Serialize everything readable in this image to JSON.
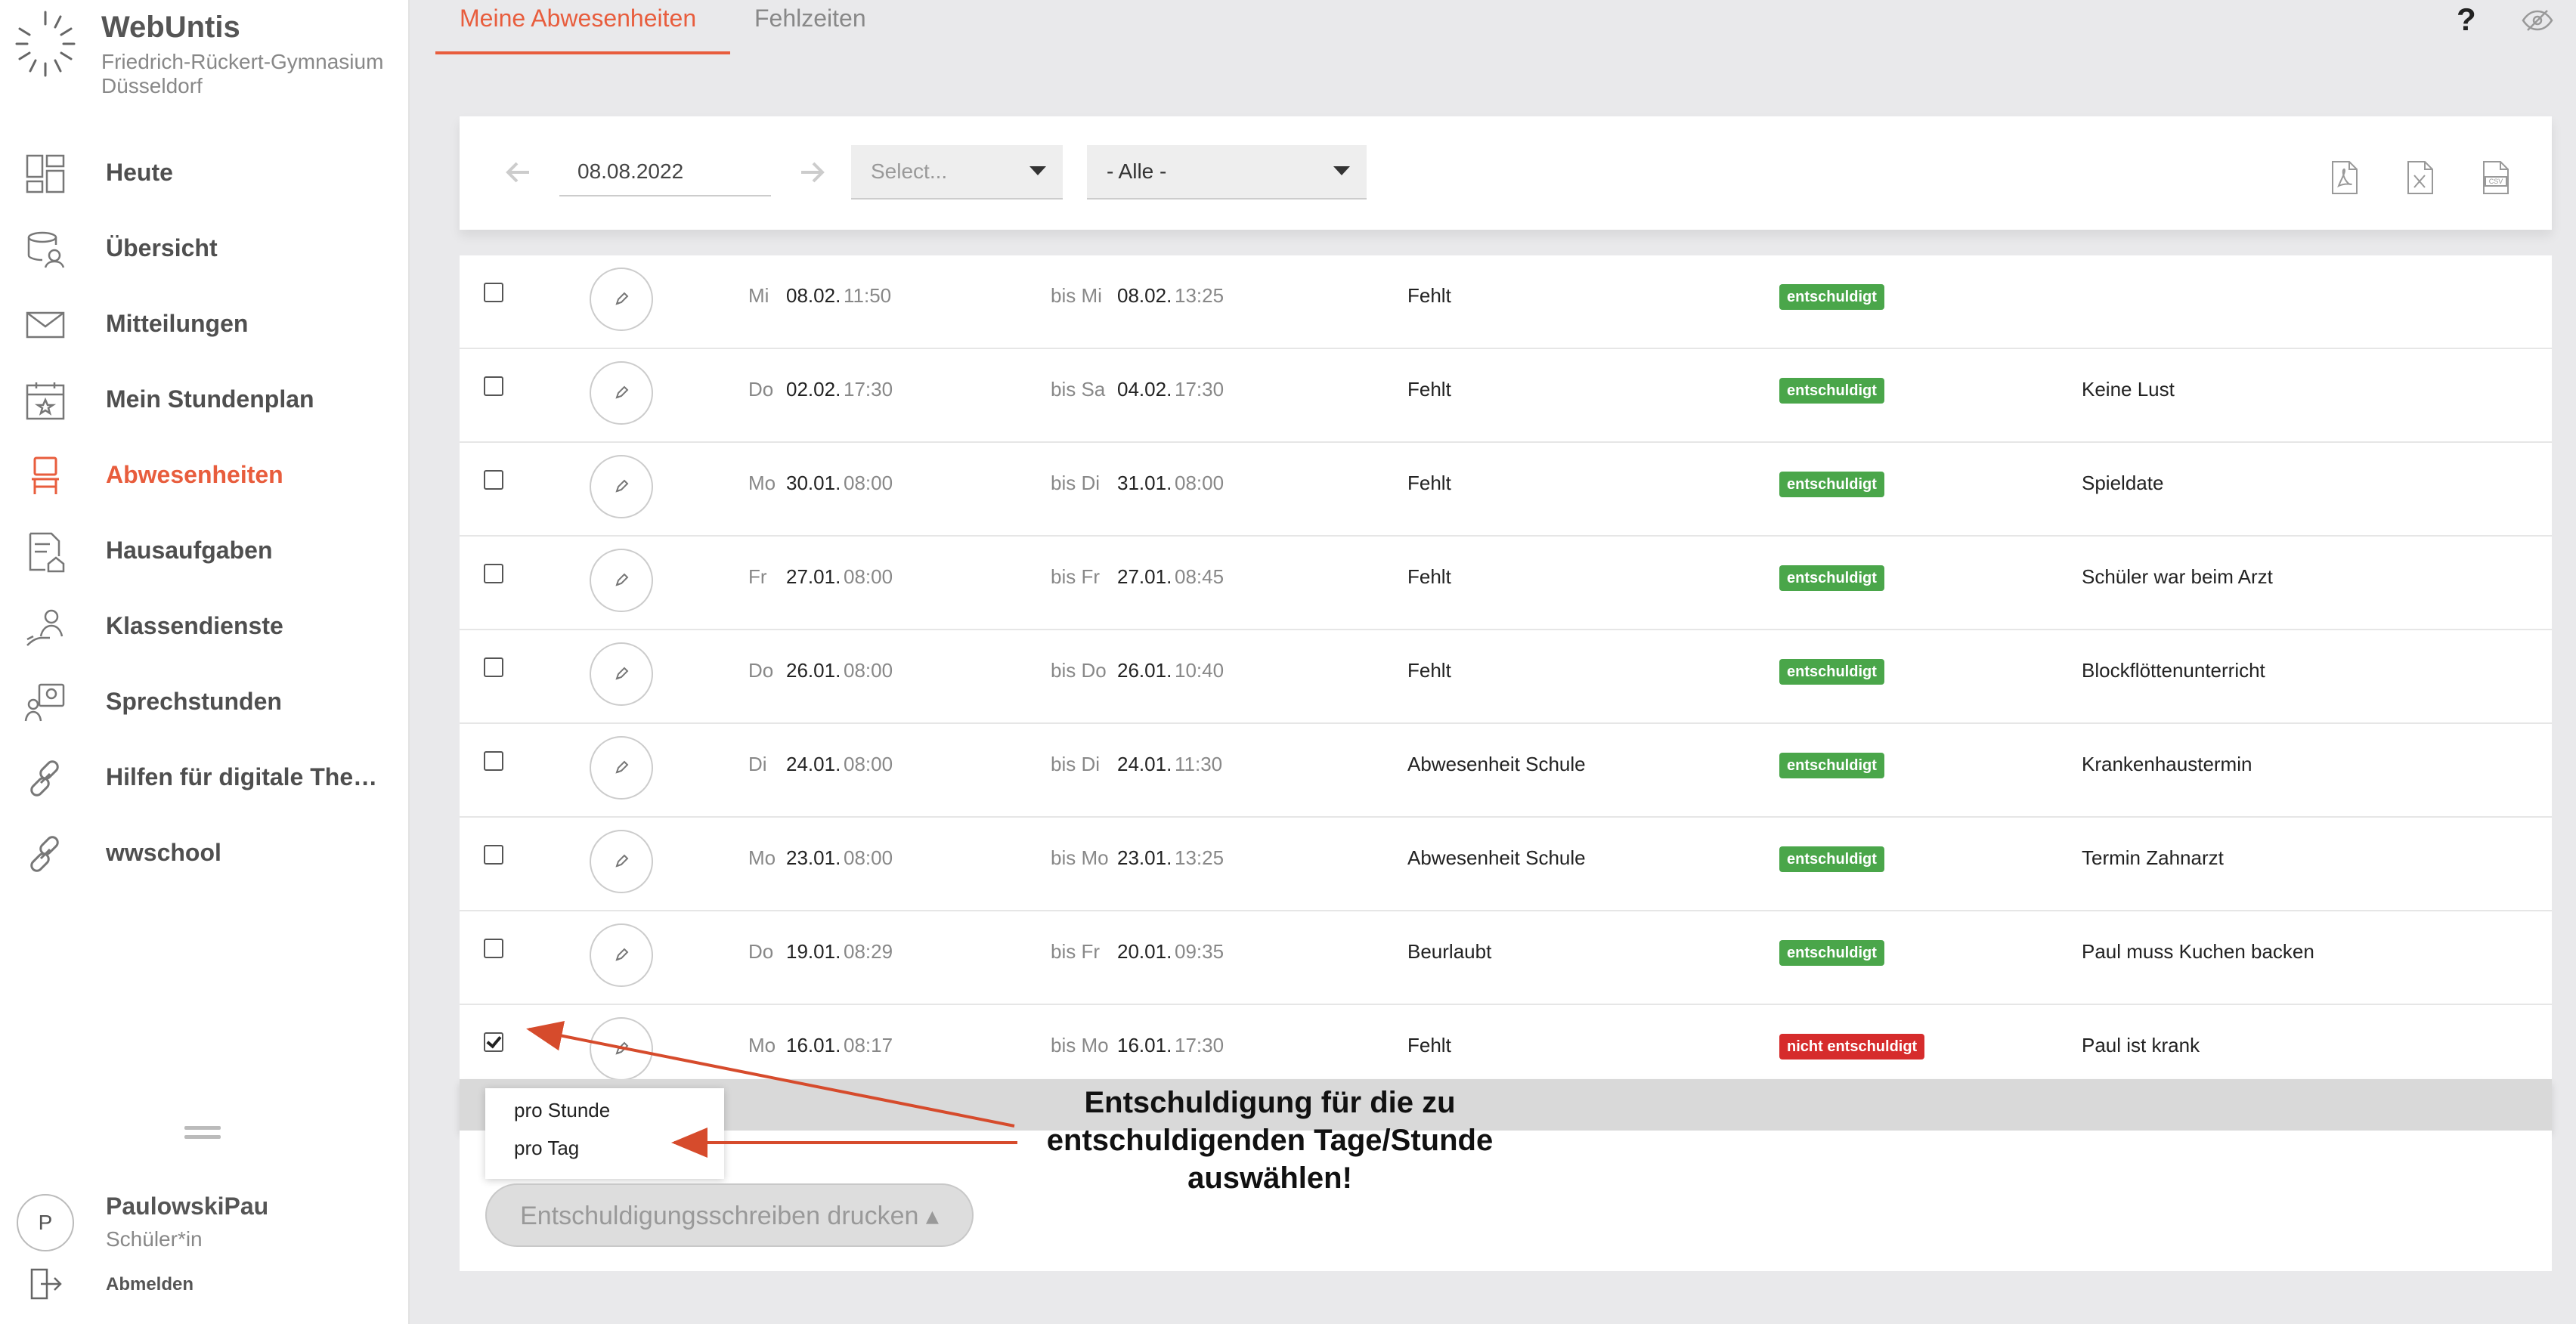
{
  "app": {
    "name": "WebUntis",
    "school": "Friedrich-Rückert-Gymnasium Düsseldorf"
  },
  "sidebar": {
    "items": [
      {
        "label": "Heute",
        "icon": "dashboard-icon",
        "active": false
      },
      {
        "label": "Übersicht",
        "icon": "overview-icon",
        "active": false
      },
      {
        "label": "Mitteilungen",
        "icon": "mail-icon",
        "active": false
      },
      {
        "label": "Mein Stundenplan",
        "icon": "calendar-icon",
        "active": false
      },
      {
        "label": "Abwesenheiten",
        "icon": "chair-icon",
        "active": true
      },
      {
        "label": "Hausaufgaben",
        "icon": "homework-icon",
        "active": false
      },
      {
        "label": "Klassendienste",
        "icon": "class-duty-icon",
        "active": false
      },
      {
        "label": "Sprechstunden",
        "icon": "consultation-icon",
        "active": false
      },
      {
        "label": "Hilfen für digitale The…",
        "icon": "link-icon",
        "active": false
      },
      {
        "label": "wwschool",
        "icon": "link-icon",
        "active": false
      }
    ],
    "user": {
      "initial": "P",
      "name": "PaulowskiPau",
      "role": "Schüler*in",
      "logout": "Abmelden"
    }
  },
  "tabs": [
    {
      "label": "Meine Abwesenheiten",
      "active": true
    },
    {
      "label": "Fehlzeiten",
      "active": false
    }
  ],
  "help": "?",
  "filter": {
    "date": "08.08.2022",
    "select1": "Select...",
    "select2": "- Alle -",
    "exports": [
      "pdf-export-icon",
      "excel-export-icon",
      "csv-export-icon"
    ]
  },
  "colors": {
    "accent": "#e85d3d",
    "excused": "#4aa64a",
    "unexcused": "#d62c2c"
  },
  "rows": [
    {
      "checked": false,
      "fromDay": "Mi",
      "fromDate": "08.02.",
      "fromTime": "11:50",
      "toPrefix": "bis Mi",
      "toDate": "08.02.",
      "toTime": "13:25",
      "reason": "Fehlt",
      "status": "entschuldigt",
      "excused": true,
      "note": ""
    },
    {
      "checked": false,
      "fromDay": "Do",
      "fromDate": "02.02.",
      "fromTime": "17:30",
      "toPrefix": "bis Sa",
      "toDate": "04.02.",
      "toTime": "17:30",
      "reason": "Fehlt",
      "status": "entschuldigt",
      "excused": true,
      "note": "Keine Lust"
    },
    {
      "checked": false,
      "fromDay": "Mo",
      "fromDate": "30.01.",
      "fromTime": "08:00",
      "toPrefix": "bis Di",
      "toDate": "31.01.",
      "toTime": "08:00",
      "reason": "Fehlt",
      "status": "entschuldigt",
      "excused": true,
      "note": "Spieldate"
    },
    {
      "checked": false,
      "fromDay": "Fr",
      "fromDate": "27.01.",
      "fromTime": "08:00",
      "toPrefix": "bis Fr",
      "toDate": "27.01.",
      "toTime": "08:45",
      "reason": "Fehlt",
      "status": "entschuldigt",
      "excused": true,
      "note": "Schüler war beim Arzt"
    },
    {
      "checked": false,
      "fromDay": "Do",
      "fromDate": "26.01.",
      "fromTime": "08:00",
      "toPrefix": "bis Do",
      "toDate": "26.01.",
      "toTime": "10:40",
      "reason": "Fehlt",
      "status": "entschuldigt",
      "excused": true,
      "note": "Blockflöttenunterricht"
    },
    {
      "checked": false,
      "fromDay": "Di",
      "fromDate": "24.01.",
      "fromTime": "08:00",
      "toPrefix": "bis Di",
      "toDate": "24.01.",
      "toTime": "11:30",
      "reason": "Abwesenheit Schule",
      "status": "entschuldigt",
      "excused": true,
      "note": "Krankenhaustermin"
    },
    {
      "checked": false,
      "fromDay": "Mo",
      "fromDate": "23.01.",
      "fromTime": "08:00",
      "toPrefix": "bis Mo",
      "toDate": "23.01.",
      "toTime": "13:25",
      "reason": "Abwesenheit Schule",
      "status": "entschuldigt",
      "excused": true,
      "note": "Termin Zahnarzt"
    },
    {
      "checked": false,
      "fromDay": "Do",
      "fromDate": "19.01.",
      "fromTime": "08:29",
      "toPrefix": "bis Fr",
      "toDate": "20.01.",
      "toTime": "09:35",
      "reason": "Beurlaubt",
      "status": "entschuldigt",
      "excused": true,
      "note": "Paul muss Kuchen backen"
    },
    {
      "checked": true,
      "fromDay": "Mo",
      "fromDate": "16.01.",
      "fromTime": "08:17",
      "toPrefix": "bis Mo",
      "toDate": "16.01.",
      "toTime": "17:30",
      "reason": "Fehlt",
      "status": "nicht entschuldigt",
      "excused": false,
      "note": "Paul ist krank"
    }
  ],
  "dropdown": {
    "items": [
      "pro Stunde",
      "pro Tag"
    ]
  },
  "print_button": "Entschuldigungsschreiben drucken ▴",
  "annotation": {
    "lines": [
      "Entschuldigung für die zu",
      "entschuldigenden Tage/Stunde",
      "auswählen!"
    ]
  }
}
